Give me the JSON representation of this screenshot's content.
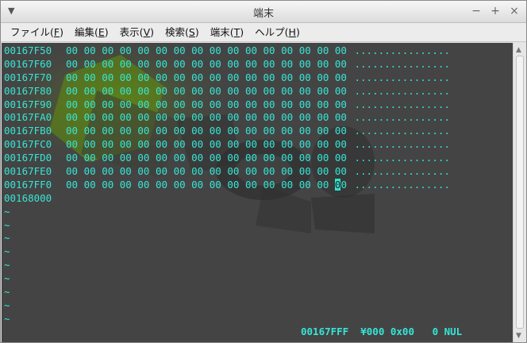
{
  "window": {
    "title": "端末"
  },
  "menu": [
    {
      "label": "ファイル(",
      "key": "F",
      "suffix": ")"
    },
    {
      "label": "編集(",
      "key": "E",
      "suffix": ")"
    },
    {
      "label": "表示(",
      "key": "V",
      "suffix": ")"
    },
    {
      "label": "検索(",
      "key": "S",
      "suffix": ")"
    },
    {
      "label": "端末(",
      "key": "T",
      "suffix": ")"
    },
    {
      "label": "ヘルプ(",
      "key": "H",
      "suffix": ")"
    }
  ],
  "dump": {
    "rows": [
      {
        "addr": "00167F50",
        "bytes": [
          "00",
          "00",
          "00",
          "00",
          "00",
          "00",
          "00",
          "00",
          "00",
          "00",
          "00",
          "00",
          "00",
          "00",
          "00",
          "00"
        ],
        "ascii": "................"
      },
      {
        "addr": "00167F60",
        "bytes": [
          "00",
          "00",
          "00",
          "00",
          "00",
          "00",
          "00",
          "00",
          "00",
          "00",
          "00",
          "00",
          "00",
          "00",
          "00",
          "00"
        ],
        "ascii": "................"
      },
      {
        "addr": "00167F70",
        "bytes": [
          "00",
          "00",
          "00",
          "00",
          "00",
          "00",
          "00",
          "00",
          "00",
          "00",
          "00",
          "00",
          "00",
          "00",
          "00",
          "00"
        ],
        "ascii": "................"
      },
      {
        "addr": "00167F80",
        "bytes": [
          "00",
          "00",
          "00",
          "00",
          "00",
          "00",
          "00",
          "00",
          "00",
          "00",
          "00",
          "00",
          "00",
          "00",
          "00",
          "00"
        ],
        "ascii": "................"
      },
      {
        "addr": "00167F90",
        "bytes": [
          "00",
          "00",
          "00",
          "00",
          "00",
          "00",
          "00",
          "00",
          "00",
          "00",
          "00",
          "00",
          "00",
          "00",
          "00",
          "00"
        ],
        "ascii": "................"
      },
      {
        "addr": "00167FA0",
        "bytes": [
          "00",
          "00",
          "00",
          "00",
          "00",
          "00",
          "00",
          "00",
          "00",
          "00",
          "00",
          "00",
          "00",
          "00",
          "00",
          "00"
        ],
        "ascii": "................"
      },
      {
        "addr": "00167FB0",
        "bytes": [
          "00",
          "00",
          "00",
          "00",
          "00",
          "00",
          "00",
          "00",
          "00",
          "00",
          "00",
          "00",
          "00",
          "00",
          "00",
          "00"
        ],
        "ascii": "................"
      },
      {
        "addr": "00167FC0",
        "bytes": [
          "00",
          "00",
          "00",
          "00",
          "00",
          "00",
          "00",
          "00",
          "00",
          "00",
          "00",
          "00",
          "00",
          "00",
          "00",
          "00"
        ],
        "ascii": "................"
      },
      {
        "addr": "00167FD0",
        "bytes": [
          "00",
          "00",
          "00",
          "00",
          "00",
          "00",
          "00",
          "00",
          "00",
          "00",
          "00",
          "00",
          "00",
          "00",
          "00",
          "00"
        ],
        "ascii": "................"
      },
      {
        "addr": "00167FE0",
        "bytes": [
          "00",
          "00",
          "00",
          "00",
          "00",
          "00",
          "00",
          "00",
          "00",
          "00",
          "00",
          "00",
          "00",
          "00",
          "00",
          "00"
        ],
        "ascii": "................"
      },
      {
        "addr": "00167FF0",
        "bytes": [
          "00",
          "00",
          "00",
          "00",
          "00",
          "00",
          "00",
          "00",
          "00",
          "00",
          "00",
          "00",
          "00",
          "00",
          "00",
          "00"
        ],
        "ascii": "................",
        "cursor_byte": 15
      }
    ],
    "end_addr": "00168000",
    "tilde": "~",
    "tilde_count": 9
  },
  "status": {
    "text": "00167FFF  ¥000 0x00   0 NUL"
  },
  "colors": {
    "text": "#36e6d6",
    "background": "#444444"
  }
}
